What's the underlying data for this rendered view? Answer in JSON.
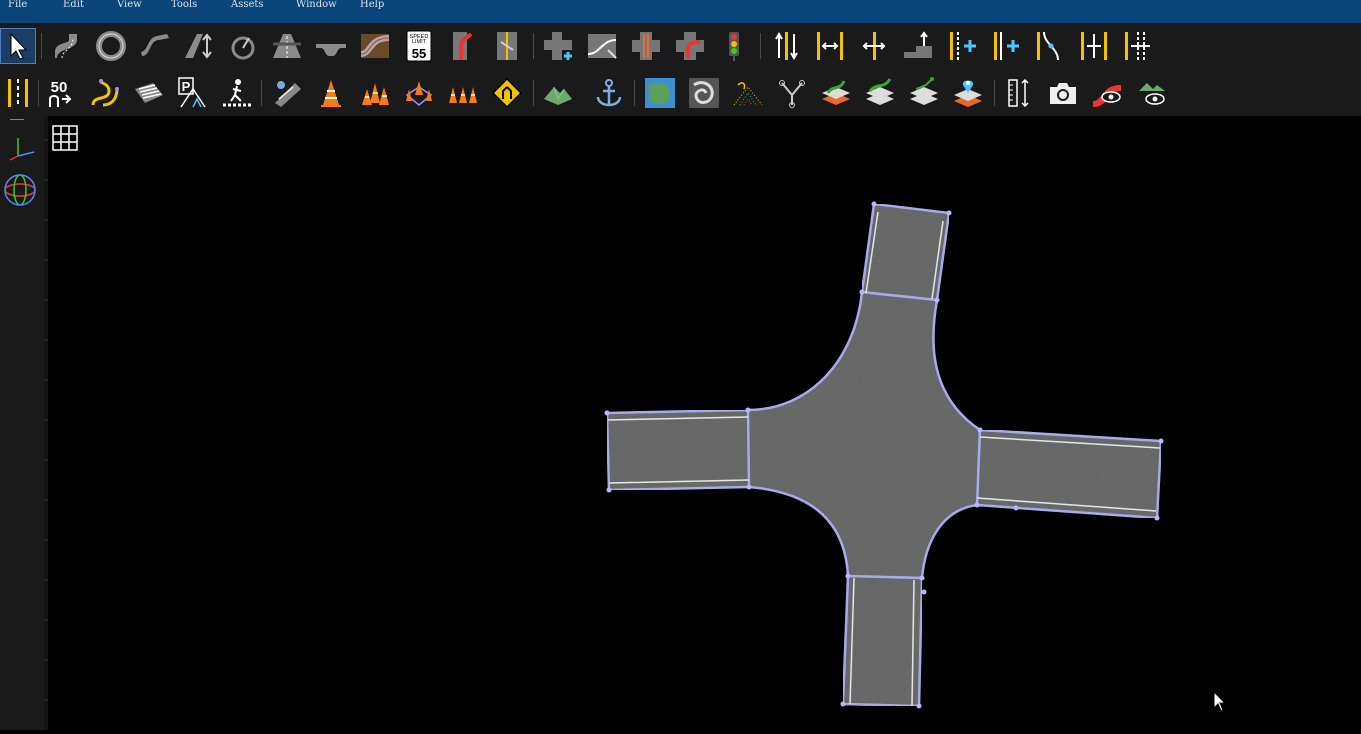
{
  "menu": {
    "items": [
      "File",
      "Edit",
      "View",
      "Tools",
      "Assets",
      "Window",
      "Help"
    ]
  },
  "toolbar": {
    "speed_limit_sign": {
      "line1": "SPEED",
      "line2": "LIMIT",
      "value": "55"
    },
    "speed_marking_value": "50",
    "parking_letter": "P"
  },
  "viewport": {
    "background": "#000000",
    "road_color": "#5e615e",
    "outline_color": "#a8a8f0",
    "lane_line_color": "#e6e6e6"
  },
  "colors": {
    "menubar": "#0a4478",
    "toolbar": "#1a1a1a",
    "accent_yellow": "#f2c200",
    "selection": "#1c3d66"
  }
}
